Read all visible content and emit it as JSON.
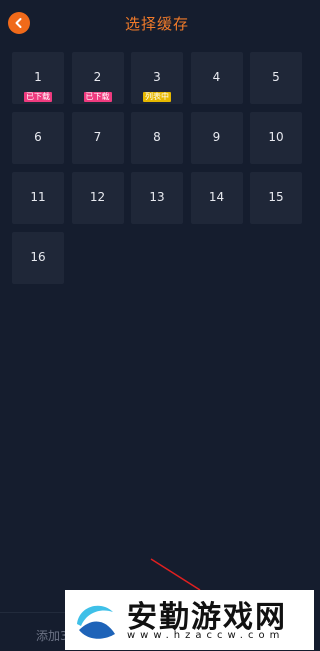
{
  "header": {
    "title": "选择缓存",
    "back_icon": "chevron-left-icon"
  },
  "episodes": [
    {
      "num": "1",
      "badge": "已下载",
      "badge_color": "#ef3b7f"
    },
    {
      "num": "2",
      "badge": "已下载",
      "badge_color": "#ef3b7f"
    },
    {
      "num": "3",
      "badge": "列表中",
      "badge_color": "#e6b800"
    },
    {
      "num": "4"
    },
    {
      "num": "5"
    },
    {
      "num": "6"
    },
    {
      "num": "7"
    },
    {
      "num": "8"
    },
    {
      "num": "9"
    },
    {
      "num": "10"
    },
    {
      "num": "11"
    },
    {
      "num": "12"
    },
    {
      "num": "13"
    },
    {
      "num": "14"
    },
    {
      "num": "15"
    },
    {
      "num": "16"
    }
  ],
  "bottom": {
    "add_label": "添加3"
  },
  "watermark": {
    "text": "安勤游戏网",
    "url": "www.hzaccw.com"
  },
  "colors": {
    "accent": "#f07a2a",
    "background": "#151d2e",
    "cell": "#1f2738"
  }
}
